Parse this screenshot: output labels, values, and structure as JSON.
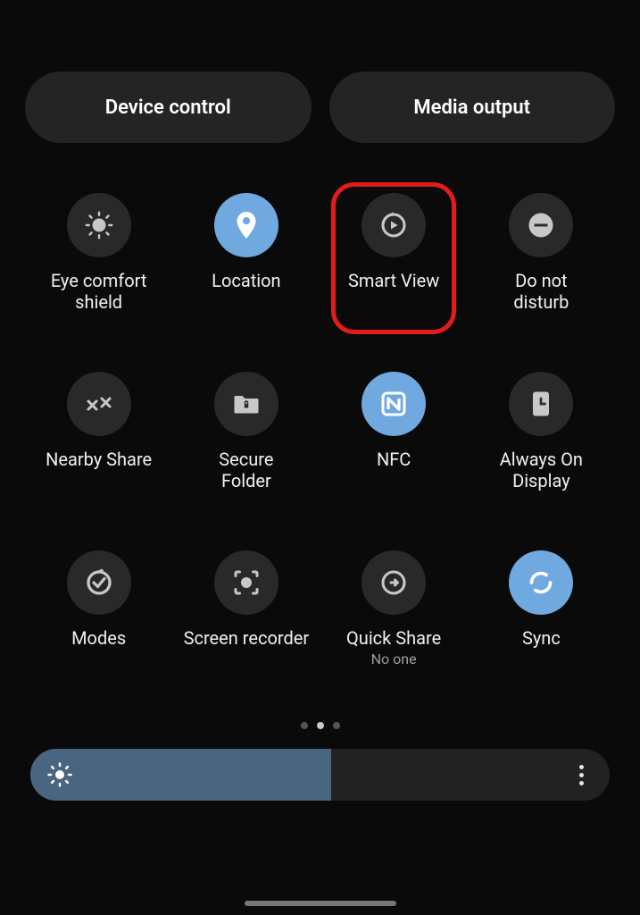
{
  "top": {
    "device_control": "Device control",
    "media_output": "Media output"
  },
  "tiles": [
    {
      "label": "Eye comfort\nshield",
      "sublabel": "",
      "active": false,
      "icon": "eye-comfort",
      "highlighted": false
    },
    {
      "label": "Location",
      "sublabel": "",
      "active": true,
      "icon": "location",
      "highlighted": false
    },
    {
      "label": "Smart View",
      "sublabel": "",
      "active": false,
      "icon": "smart-view",
      "highlighted": true
    },
    {
      "label": "Do not\ndisturb",
      "sublabel": "",
      "active": false,
      "icon": "dnd",
      "highlighted": false
    },
    {
      "label": "Nearby Share",
      "sublabel": "",
      "active": false,
      "icon": "nearby-share",
      "highlighted": false
    },
    {
      "label": "Secure\nFolder",
      "sublabel": "",
      "active": false,
      "icon": "secure-folder",
      "highlighted": false
    },
    {
      "label": "NFC",
      "sublabel": "",
      "active": true,
      "icon": "nfc",
      "highlighted": false
    },
    {
      "label": "Always On\nDisplay",
      "sublabel": "",
      "active": false,
      "icon": "always-on",
      "highlighted": false
    },
    {
      "label": "Modes",
      "sublabel": "",
      "active": false,
      "icon": "modes",
      "highlighted": false
    },
    {
      "label": "Screen recorder",
      "sublabel": "",
      "active": false,
      "icon": "screen-recorder",
      "highlighted": false
    },
    {
      "label": "Quick Share",
      "sublabel": "No one",
      "active": false,
      "icon": "quick-share",
      "highlighted": false
    },
    {
      "label": "Sync",
      "sublabel": "",
      "active": true,
      "icon": "sync",
      "highlighted": false
    }
  ],
  "pager": {
    "count": 3,
    "active": 1
  },
  "brightness": {
    "percent": 52
  }
}
